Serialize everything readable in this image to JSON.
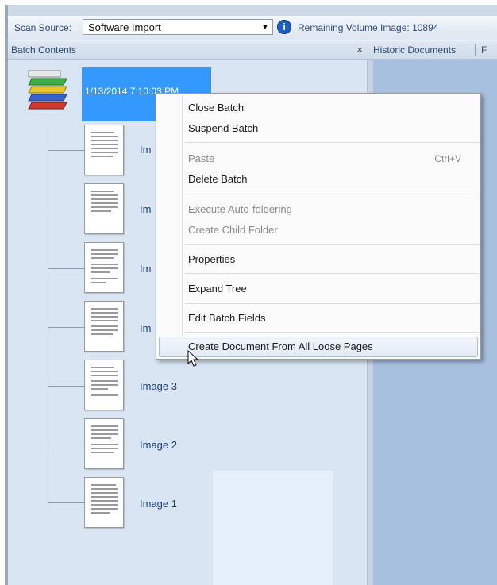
{
  "toolbar": {
    "scan_source_label": "Scan Source:",
    "scan_source_value": "Software Import",
    "info_icon": "info-icon",
    "remaining_volume": "Remaining Volume Image: 10894"
  },
  "batch_panel": {
    "title": "Batch Contents",
    "close_glyph": "×"
  },
  "tabs": [
    {
      "label": "Historic Documents"
    },
    {
      "label": "F"
    }
  ],
  "tree": {
    "batch_label": "1/13/2014 7:10:03 PM",
    "images": [
      {
        "label": "Im"
      },
      {
        "label": "Im"
      },
      {
        "label": "Im"
      },
      {
        "label": "Im"
      },
      {
        "label": "Image 3"
      },
      {
        "label": "Image 2"
      },
      {
        "label": "Image 1"
      }
    ]
  },
  "context_menu": {
    "items": [
      {
        "label": "Close Batch",
        "enabled": true
      },
      {
        "label": "Suspend Batch",
        "enabled": true
      },
      {
        "label": "Paste",
        "shortcut": "Ctrl+V",
        "enabled": false
      },
      {
        "label": "Delete Batch",
        "enabled": true
      },
      {
        "label": "Execute Auto-foldering",
        "enabled": false
      },
      {
        "label": "Create Child Folder",
        "enabled": false
      },
      {
        "label": "Properties",
        "enabled": true
      },
      {
        "label": "Expand Tree",
        "enabled": true
      },
      {
        "label": "Edit Batch Fields",
        "enabled": true
      },
      {
        "label": "Create Document From All Loose Pages",
        "enabled": true,
        "hovered": true
      }
    ]
  },
  "colors": {
    "selection": "#3399ff",
    "tree_background": "#d9e5f2",
    "right_pane": "#a8c0e0"
  }
}
